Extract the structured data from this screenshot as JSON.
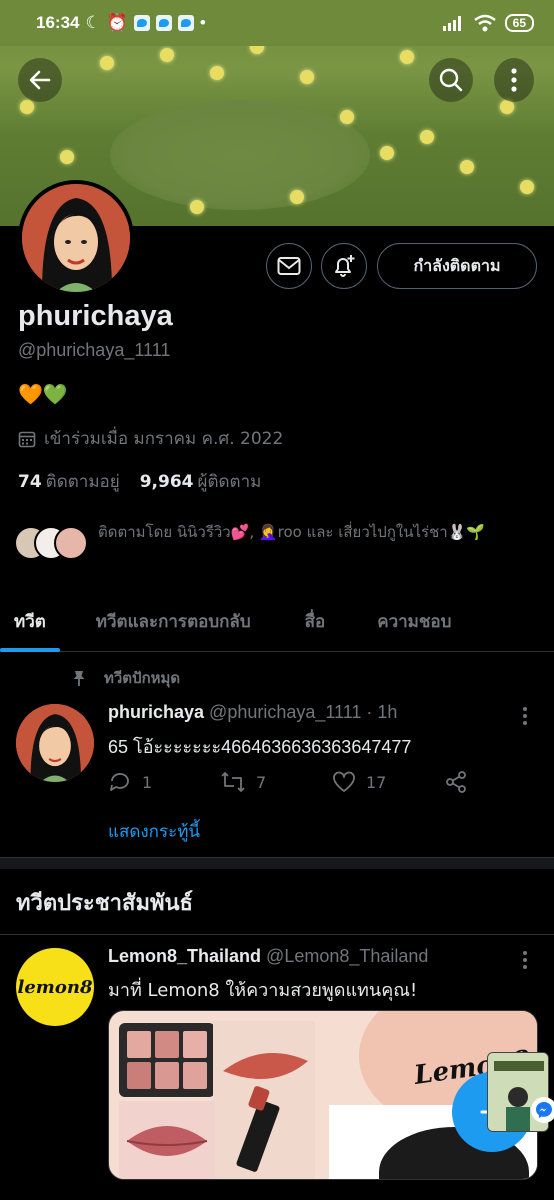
{
  "status_bar": {
    "time": "16:34",
    "battery": "65"
  },
  "profile": {
    "display_name": "phurichaya",
    "handle": "@phurichaya_1111",
    "bio": "🧡💚",
    "joined": "เข้าร่วมเมื่อ มกราคม ค.ศ. 2022",
    "following_count": "74",
    "following_label": "ติดตามอยู่",
    "followers_count": "9,964",
    "followers_label": "ผู้ติดตาม",
    "following_button": "กำลังติดตาม",
    "followed_by_text": "ติดตามโดย นินิวรีวิว💕, 🤦‍♀️roo และ เสี่ยวไปกูในไร่ชา🐰🌱"
  },
  "tabs": [
    {
      "label": "ทวีต",
      "active": true
    },
    {
      "label": "ทวีตและการตอบกลับ",
      "active": false
    },
    {
      "label": "สื่อ",
      "active": false
    },
    {
      "label": "ความชอบ",
      "active": false
    }
  ],
  "pinned_tweet": {
    "pinned_label": "ทวีตปักหมุด",
    "author": "phurichaya",
    "handle_time": "@phurichaya_1111 · 1h",
    "text": "65 โอ้ะะะะะะะ4664636636363647477",
    "replies": "1",
    "retweets": "7",
    "likes": "17",
    "show_thread": "แสดงกระทู้นี้"
  },
  "promoted": {
    "section_title": "ทวีตประชาสัมพันธ์",
    "author": "Lemon8_Thailand",
    "handle": "@Lemon8_Thailand",
    "text": "มาที่ Lemon8 ให้ความสวยพูดแทนคุณ!",
    "avatar_text": "lemon8",
    "card_brand": "Lemon8"
  },
  "colors": {
    "accent": "#1d9bf0",
    "background": "#000000",
    "muted": "#71767b"
  }
}
